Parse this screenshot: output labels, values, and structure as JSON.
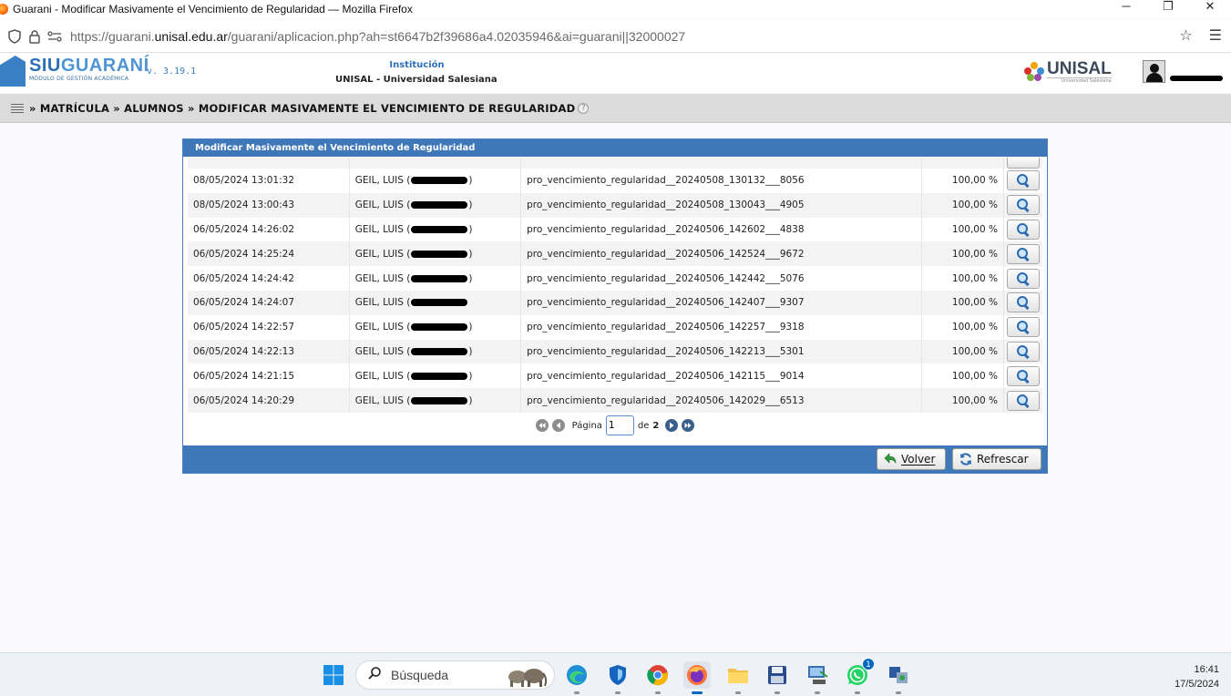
{
  "window": {
    "title": "Guarani - Modificar Masivamente el Vencimiento de Regularidad — Mozilla Firefox"
  },
  "browser": {
    "url_prefix": "https://guarani.",
    "url_domain": "unisal.edu.ar",
    "url_rest": "/guarani/aplicacion.php?ah=st6647b2f39686a4.02035946&ai=guarani||32000027"
  },
  "header": {
    "logo_siu": "SIU",
    "logo_guarani": "GUARANÍ",
    "logo_sub": "MÓDULO DE GESTIÓN ACADÉMICA",
    "version": "v. 3.19.1",
    "institution_label": "Institución",
    "institution_name": "UNISAL - Universidad Salesiana",
    "unisal_logo": "UNISAL",
    "unisal_sub": "Universidad Salesiana"
  },
  "breadcrumb": {
    "text": "» MATRÍCULA » ALUMNOS » MODIFICAR MASIVAMENTE EL VENCIMIENTO DE REGULARIDAD"
  },
  "panel": {
    "title": "Modificar Masivamente el Vencimiento de Regularidad",
    "rows": [
      {
        "date": "08/05/2024 13:01:32",
        "user": "GEIL, LUIS (",
        "user_end": ")",
        "file": "pro_vencimiento_regularidad__20240508_130132___8056",
        "pct": "100,00 %"
      },
      {
        "date": "08/05/2024 13:00:43",
        "user": "GEIL, LUIS (",
        "user_end": ")",
        "file": "pro_vencimiento_regularidad__20240508_130043___4905",
        "pct": "100,00 %"
      },
      {
        "date": "06/05/2024 14:26:02",
        "user": "GEIL, LUIS (",
        "user_end": ")",
        "file": "pro_vencimiento_regularidad__20240506_142602___4838",
        "pct": "100,00 %"
      },
      {
        "date": "06/05/2024 14:25:24",
        "user": "GEIL, LUIS (",
        "user_end": ")",
        "file": "pro_vencimiento_regularidad__20240506_142524___9672",
        "pct": "100,00 %"
      },
      {
        "date": "06/05/2024 14:24:42",
        "user": "GEIL, LUIS (",
        "user_end": ")",
        "file": "pro_vencimiento_regularidad__20240506_142442___5076",
        "pct": "100,00 %"
      },
      {
        "date": "06/05/2024 14:24:07",
        "user": "GEIL, LUIS (",
        "user_end": "",
        "file": "pro_vencimiento_regularidad__20240506_142407___9307",
        "pct": "100,00 %"
      },
      {
        "date": "06/05/2024 14:22:57",
        "user": "GEIL, LUIS (",
        "user_end": ")",
        "file": "pro_vencimiento_regularidad__20240506_142257___9318",
        "pct": "100,00 %"
      },
      {
        "date": "06/05/2024 14:22:13",
        "user": "GEIL, LUIS (",
        "user_end": ")",
        "file": "pro_vencimiento_regularidad__20240506_142213___5301",
        "pct": "100,00 %"
      },
      {
        "date": "06/05/2024 14:21:15",
        "user": "GEIL, LUIS (",
        "user_end": ")",
        "file": "pro_vencimiento_regularidad__20240506_142115___9014",
        "pct": "100,00 %"
      },
      {
        "date": "06/05/2024 14:20:29",
        "user": "GEIL, LUIS (",
        "user_end": ")",
        "file": "pro_vencimiento_regularidad__20240506_142029___6513",
        "pct": "100,00 %"
      }
    ],
    "pager": {
      "label": "Página",
      "current": "1",
      "of_label": "de",
      "total": "2"
    },
    "buttons": {
      "back": "Volver",
      "refresh": "Refrescar"
    }
  },
  "taskbar": {
    "search_placeholder": "Búsqueda",
    "whatsapp_badge": "1",
    "time": "16:41",
    "date": "17/5/2024"
  }
}
